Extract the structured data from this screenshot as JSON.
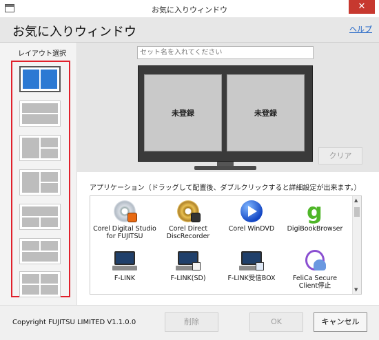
{
  "window": {
    "title": "お気に入りウィンドウ",
    "close_symbol": "✕"
  },
  "header": {
    "title": "お気に入りウィンドウ",
    "help": "ヘルプ"
  },
  "sidebar": {
    "label": "レイアウト選択"
  },
  "main": {
    "set_name_placeholder": "セット名を入れてください",
    "slots": [
      "未登録",
      "未登録"
    ],
    "clear_label": "クリア",
    "apps_label": "アプリケーション（ドラッグして配置後、ダブルクリックすると詳細設定が出来ます。）",
    "apps": [
      {
        "name1": "Corel Digital Studio",
        "name2": "for FUJITSU",
        "icon": "corel-digital-studio-icon"
      },
      {
        "name1": "Corel Direct",
        "name2": "DiscRecorder",
        "icon": "corel-direct-disc-recorder-icon"
      },
      {
        "name1": "Corel WinDVD",
        "name2": "",
        "icon": "corel-windvd-icon"
      },
      {
        "name1": "DigiBookBrowser",
        "name2": "",
        "icon": "digibook-browser-icon"
      },
      {
        "name1": "F-LINK",
        "name2": "",
        "icon": "f-link-icon"
      },
      {
        "name1": "F-LINK(SD)",
        "name2": "",
        "icon": "f-link-sd-icon"
      },
      {
        "name1": "F-LINK受信BOX",
        "name2": "",
        "icon": "f-link-inbox-icon"
      },
      {
        "name1": "FeliCa Secure",
        "name2": "Client停止",
        "icon": "felica-secure-client-icon"
      }
    ]
  },
  "footer": {
    "copyright": "Copyright FUJITSU LIMITED V1.1.0.0",
    "delete_label": "削除",
    "ok_label": "OK",
    "cancel_label": "キャンセル"
  },
  "colors": {
    "accent": "#2c79d3",
    "highlight_frame": "#e0202b",
    "close": "#c7382f",
    "link": "#1e63c6"
  }
}
